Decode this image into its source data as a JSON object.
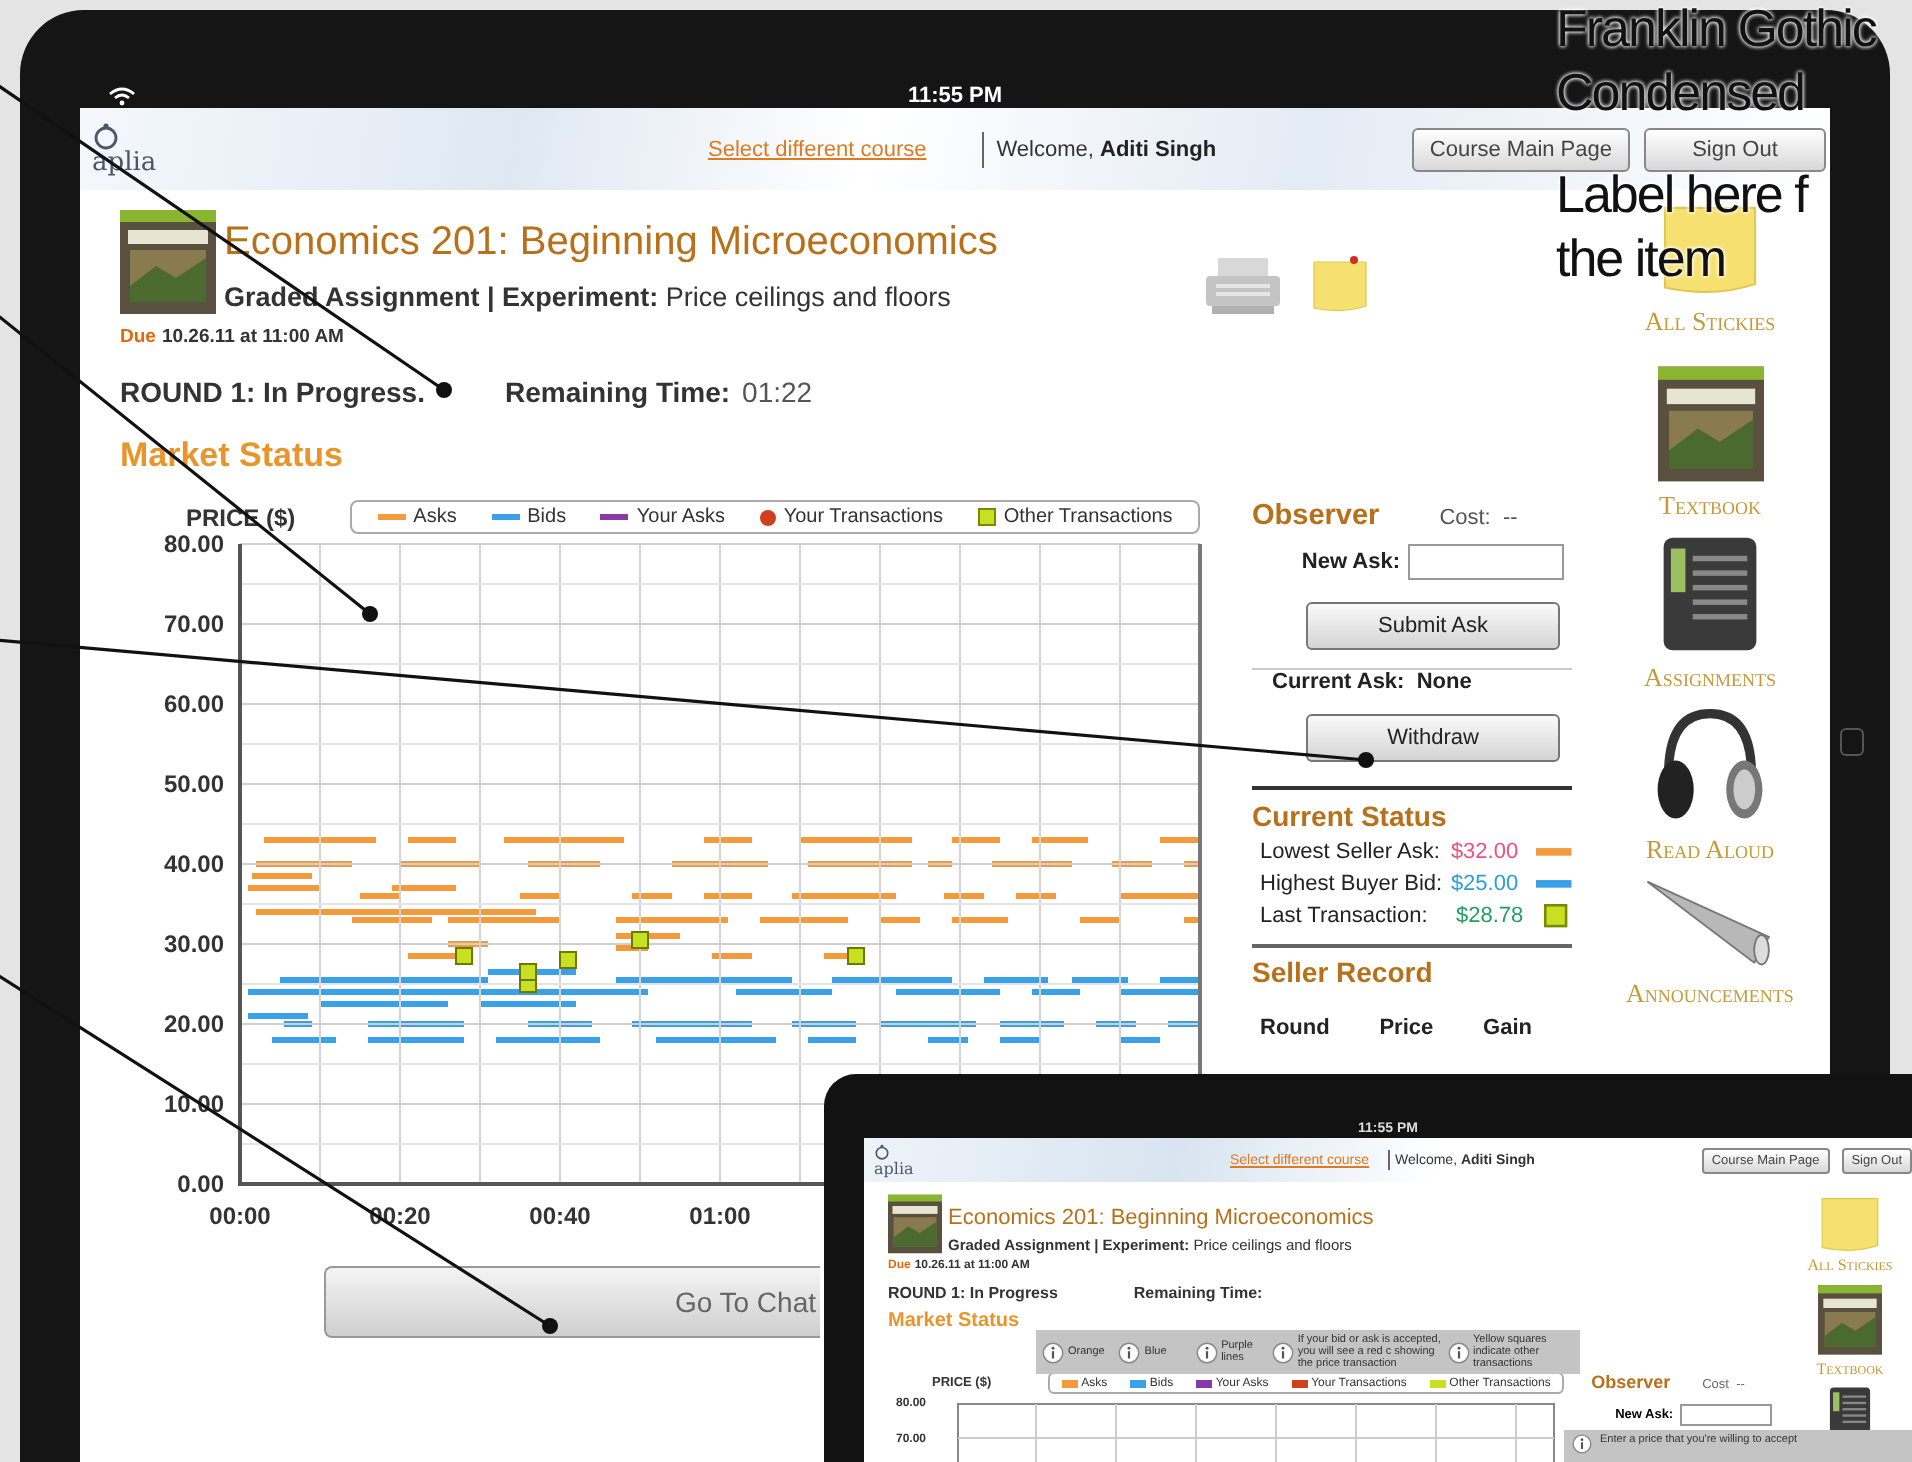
{
  "status_bar": {
    "time": "11:55 PM"
  },
  "header": {
    "logo": "aplia",
    "course_link": "Select different course",
    "welcome": "Welcome, **Aditi Singh**",
    "buttons": [
      "Course Main Page",
      "Sign Out"
    ]
  },
  "course": {
    "title": "Economics 201: Beginning Microeconomics",
    "subtitle": "**Graded Assignment | Experiment:** Price ceilings and floors",
    "due_label": "Due",
    "due": "10.26.11 at 11:00 AM"
  },
  "round": {
    "status": "ROUND 1: In Progress.",
    "remaining_label": "Remaining Time:",
    "remaining": "01:22"
  },
  "market_status": {
    "heading": "Market Status",
    "legend": [
      {
        "label": "Asks",
        "kind": "line",
        "color": "#f39a3c"
      },
      {
        "label": "Bids",
        "kind": "line",
        "color": "#3aa0e8"
      },
      {
        "label": "Your Asks",
        "kind": "line",
        "color": "#8a3aa8"
      },
      {
        "label": "Your Transactions",
        "kind": "circle",
        "color": "#d04020"
      }
    ],
    "chart_data": {
      "type": "scatter",
      "ylabel": "PRICE ($)",
      "grid": true,
      "xlim": [
        0,
        120
      ],
      "ylim": [
        0,
        80
      ],
      "xticks": [
        {
          "value": 0,
          "label": "00:00"
        },
        {
          "value": 20,
          "label": "00:20"
        },
        {
          "value": 40,
          "label": "00:40"
        },
        {
          "value": 60,
          "label": "01:00"
        }
      ],
      "yticks": [
        {
          "value": 0,
          "label": "0.00"
        },
        {
          "value": 10,
          "label": "10.00"
        },
        {
          "value": 20,
          "label": "20.00"
        },
        {
          "value": 30,
          "label": "30.00"
        },
        {
          "value": 40,
          "label": "40.00"
        },
        {
          "value": 50,
          "label": "50.00"
        },
        {
          "value": 60,
          "label": "60.00"
        },
        {
          "value": 70,
          "label": "70.00"
        },
        {
          "value": 80,
          "label": "80.00"
        }
      ],
      "x": [
        28,
        36,
        36,
        41,
        50,
        77
      ],
      "series": [
        {
          "name": "Other Transactions",
          "color": "#c8e020",
          "values": [
            28.5,
            25,
            26.5,
            28,
            30.5,
            28.5
          ]
        }
      ]
    },
    "chat_button": "Go To Chat"
  },
  "observer": {
    "heading": "Observer",
    "cost": "Cost:  --",
    "new_ask_label": "New Ask:",
    "submit": "Submit Ask",
    "current_ask": "Current Ask:  None",
    "withdraw": "Withdraw"
  },
  "current_status": {
    "heading": "Current Status",
    "rows": [
      {
        "label": "Lowest Seller Ask:",
        "value": "$32.00",
        "color": "#f0507a",
        "kind": "ask"
      },
      {
        "label": "Highest Buyer Bid:",
        "value": "$25.00",
        "color": "#2aa0d8",
        "kind": "bid"
      },
      {
        "label": "Last Transaction:",
        "value": "$28.78",
        "color": "#20a060",
        "kind": "transaction"
      }
    ]
  },
  "seller_record": {
    "heading": "Seller Record",
    "columns": [
      "Round",
      "Price",
      "Gain"
    ]
  },
  "sidebar": {
    "items": [
      {
        "label": "All Stickies",
        "kind": "sticky"
      },
      {
        "label": "Textbook",
        "kind": "book"
      },
      {
        "label": "Assignments",
        "kind": "device"
      },
      {
        "label": "Read Aloud",
        "kind": "headphones"
      },
      {
        "label": "Announcements",
        "kind": "megaphone"
      }
    ]
  },
  "annotation": {
    "lines": [
      "Franklin Gothic",
      "Condensed",
      "Label here f",
      "the item"
    ]
  },
  "inset": {
    "time": "11:55 PM",
    "logo": "aplia",
    "course_link": "Select different course",
    "welcome": "Welcome, **Aditi Singh**",
    "buttons": [
      "Course Main Page",
      "Sign Out"
    ],
    "title": "Economics 201: Beginning Microeconomics",
    "subtitle": "**Graded Assignment | Experiment:** Price ceilings and floors",
    "due_label": "Due",
    "due": "10.26.11 at 11:00 AM",
    "round": "ROUND 1: In Progress",
    "remaining_label": "Remaining Time:",
    "market_status": "Market Status",
    "tips": [
      "Orange",
      "Blue",
      "Purple lines",
      "If your bid or ask is accepted, you will see a red c showing the price transaction",
      "Yellow squares indicate other transactions"
    ],
    "price_label": "PRICE ($)",
    "legend": [
      {
        "label": "Asks",
        "color": "#f39a3c"
      },
      {
        "label": "Bids",
        "color": "#3aa0e8"
      },
      {
        "label": "Your Asks",
        "color": "#8a3aa8"
      },
      {
        "label": "Your Transactions",
        "color": "#d04020"
      },
      {
        "label": "Other Transactions",
        "color": "#c8e020"
      }
    ],
    "yticks": [
      "80.00",
      "70.00"
    ],
    "observer": "Observer",
    "cost": "Cost  --",
    "new_ask_label": "New Ask:",
    "ask_tip": "Enter a price that you're willing to accept",
    "sidebar": [
      "All Stickies",
      "Textbook"
    ]
  }
}
